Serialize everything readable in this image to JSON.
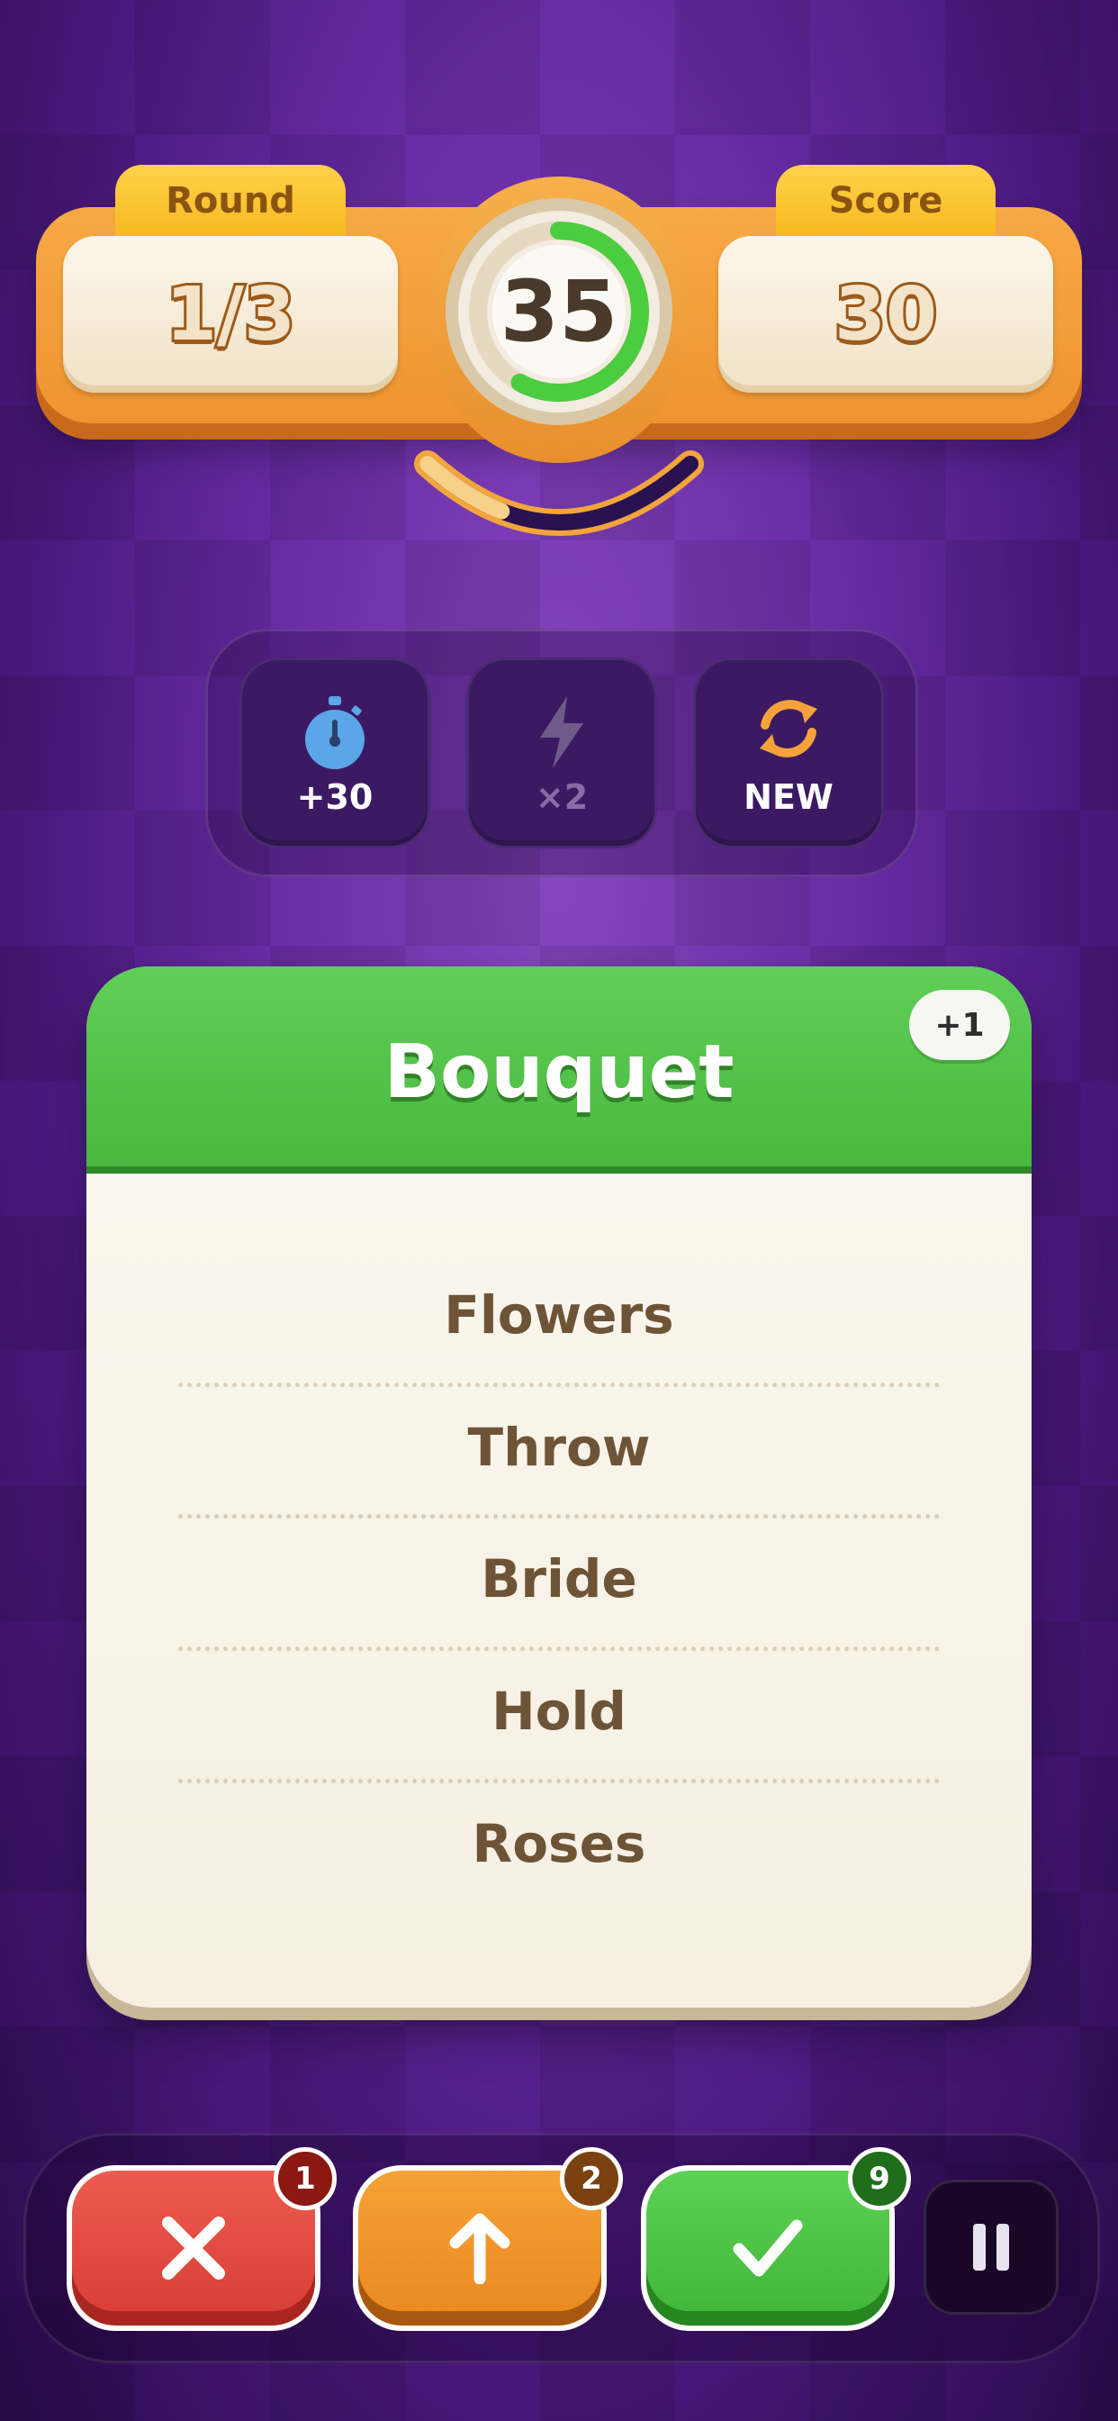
{
  "hud": {
    "round_label": "Round",
    "round_value": "1/3",
    "score_label": "Score",
    "score_value": "30",
    "timer_value": "35",
    "timer_progress": 0.58,
    "timer_arc_progress": 0.3
  },
  "powerups": [
    {
      "icon": "stopwatch-icon",
      "label": "+30",
      "enabled": true
    },
    {
      "icon": "lightning-icon",
      "label": "×2",
      "enabled": false
    },
    {
      "icon": "refresh-icon",
      "label": "NEW",
      "enabled": true
    }
  ],
  "card": {
    "title": "Bouquet",
    "bonus": "+1",
    "taboo_words": [
      "Flowers",
      "Throw",
      "Bride",
      "Hold",
      "Roses"
    ]
  },
  "actions": {
    "skip_badge": "1",
    "pass_badge": "2",
    "correct_badge": "9"
  },
  "colors": {
    "accent_orange": "#f09a35",
    "card_green": "#52c44a",
    "skip_red": "#e04a41",
    "correct_green": "#4cc344"
  }
}
